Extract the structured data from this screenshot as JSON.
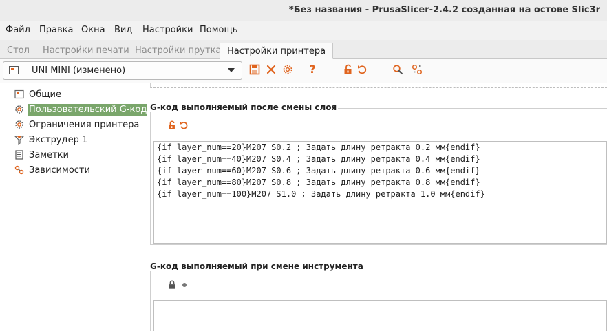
{
  "window": {
    "title": "*Без названия - PrusaSlicer-2.4.2 созданная на остове Slic3r"
  },
  "menu": [
    "Файл",
    "Правка",
    "Окна",
    "Вид",
    "Настройки",
    "Помощь"
  ],
  "tabs": [
    {
      "label": "Стол"
    },
    {
      "label": "Настройки печати"
    },
    {
      "label": "Настройки прутка"
    },
    {
      "label": "Настройки принтера",
      "active": true
    }
  ],
  "preset": {
    "selected": "UNI MINI (изменено)"
  },
  "toolbar_icons": [
    "save-icon",
    "delete-icon",
    "gear-icon",
    "help-icon",
    "unlock-icon",
    "undo-icon",
    "search-icon",
    "compare-icon"
  ],
  "sidebar": {
    "items": [
      {
        "label": "Общие",
        "icon": "printer-icon"
      },
      {
        "label": "Пользовательский G-код",
        "icon": "gear-icon",
        "selected": true
      },
      {
        "label": "Ограничения принтера",
        "icon": "gear-icon"
      },
      {
        "label": "Экструдер 1",
        "icon": "funnel-icon"
      },
      {
        "label": "Заметки",
        "icon": "notes-icon"
      },
      {
        "label": "Зависимости",
        "icon": "dependencies-icon"
      }
    ]
  },
  "sections": [
    {
      "title": "G-код выполняемый после смены слоя",
      "code": [
        "{if layer_num==20}M207 S0.2 ; Задать длину ретракта 0.2 мм{endif}",
        "{if layer_num==40}M207 S0.4 ; Задать длину ретракта 0.4 мм{endif}",
        "{if layer_num==60}M207 S0.6 ; Задать длину ретракта 0.6 мм{endif}",
        "{if layer_num==80}M207 S0.8 ; Задать длину ретракта 0.8 мм{endif}",
        "{if layer_num==100}M207 S1.0 ; Задать длину ретракта 1.0 мм{endif}"
      ]
    },
    {
      "title": "G-код выполняемый при смене инструмента",
      "code": []
    }
  ],
  "colors": {
    "accent": "#e0641e",
    "selection": "#7aa66b"
  }
}
